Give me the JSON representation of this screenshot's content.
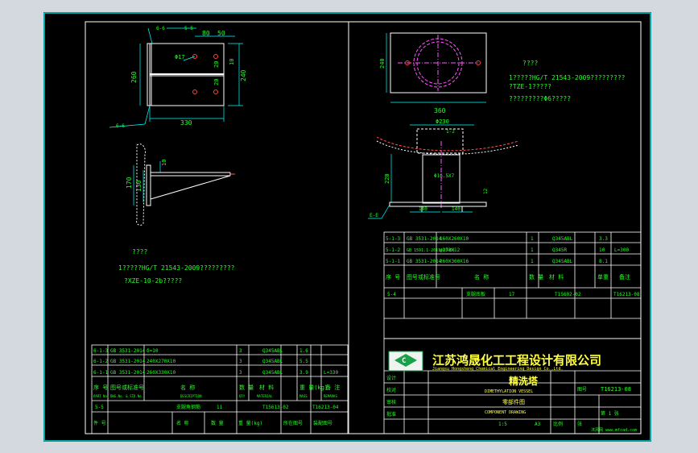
{
  "colors": {
    "background": "#000000",
    "frame": "#00e0e0",
    "drawing": "#ffffff",
    "dimension": "#00ffff",
    "text_green": "#22ff22",
    "text_yellow": "#ffff44",
    "center_line": "#ff55ff",
    "hole": "#ff4444",
    "logo_green": "#1aa04a"
  },
  "left": {
    "plan_view": {
      "section_label_a": "5-5",
      "section_label_b": "6-6",
      "section_label_c": "6-6",
      "dims": {
        "top_80": "80",
        "top_50": "50",
        "hole_dia": "Φ17",
        "right_10": "10",
        "right_240": "240",
        "left_260": "260",
        "inner_20a": "20",
        "inner_20b": "20",
        "bottom_330": "330"
      }
    },
    "side_view": {
      "dims": {
        "d_170": "170",
        "d_130": "130",
        "d_10": "10"
      }
    },
    "notes": {
      "title": "????",
      "line1": "1?????HG/T 21543-2009?????????",
      "line2": "?XZE-10-2b?????"
    },
    "parts_table": {
      "rows": [
        {
          "no": "6-1-3",
          "std": "GB 3531-2014",
          "name": "δ=10",
          "qty": "3",
          "mat": "Q345ABL",
          "w1": "1.6",
          "w2": "",
          "note": ""
        },
        {
          "no": "6-1-2",
          "std": "GB 3531-2014",
          "name": "240X270X10",
          "qty": "3",
          "mat": "Q345ABL",
          "w1": "5.5",
          "w2": "",
          "note": ""
        },
        {
          "no": "6-1-1",
          "std": "GB 3531-2014",
          "name": "260X330X10",
          "qty": "3",
          "mat": "Q345ABL",
          "w1": "3.9",
          "w2": "",
          "note": "L=330"
        }
      ],
      "header": {
        "no": "序 号",
        "std": "图号或标准号",
        "name": "名 称",
        "qty": "数 量",
        "mat": "材 料",
        "weight": "重 量(kg)",
        "note": "备 注",
        "sub_no": "PART No.",
        "sub_std": "DWG.No. & STD.No.",
        "sub_name": "DESCRIPTION",
        "sub_qty": "QTY",
        "sub_mat": "MATERIAL",
        "sub_weight": "MASS",
        "sub_note": "REMARKS"
      },
      "footer": {
        "no": "5-5",
        "name": "支腿角钢筋",
        "qty": "11",
        "drawing": "T15613-02",
        "ref": "T16213-04",
        "lbl_no": "件 号",
        "lbl_name": "名 称",
        "lbl_qty": "数 量",
        "lbl_weight": "重 量(kg)",
        "lbl_dwg": "所在图号",
        "lbl_ref": "装配图号"
      }
    }
  },
  "right": {
    "top_view": {
      "dim_240": "240",
      "dim_360": "360"
    },
    "notes": {
      "title": "????",
      "line1": "1?????HG/T 21543-2009?????????",
      "line2": "?TZE-1?????",
      "line3": "?????????Φ6?????"
    },
    "front_view": {
      "dims": {
        "phi230": "Φ230",
        "label_1_2": "1-2",
        "phi16": "Φ16.5X7",
        "d_220": "220",
        "d_140a": "140",
        "d_140b": "140",
        "d_12": "12"
      },
      "section_label": "E-E"
    },
    "parts_table": {
      "rows": [
        {
          "no": "5-1-3",
          "std": "GB 3531-2014",
          "name": "160X260X10",
          "qty": "1",
          "mat": "Q345ABL",
          "w": "3.3",
          "note": ""
        },
        {
          "no": "5-1-2",
          "std": "GB 1591.1-2011(Q345)",
          "name": "φ273X12",
          "qty": "1",
          "mat": "Q345R",
          "w": "10",
          "note": "L=300"
        },
        {
          "no": "5-1-1",
          "std": "GB 3531-2014",
          "name": "260X360X16",
          "qty": "1",
          "mat": "Q345ABL",
          "w": "8.1",
          "note": ""
        }
      ],
      "header": {
        "no": "序 号",
        "std": "图号或标准号",
        "name": "名 称",
        "qty": "数 量",
        "mat": "材 料",
        "w": "单重",
        "note": "备注"
      },
      "footer": {
        "no": "5-4",
        "name": "支腿底板",
        "qty": "17",
        "drawing": "T15602-02",
        "ref": "T16213-08"
      }
    },
    "title_block": {
      "company": "江苏鸿晟化工工程设计有限公司",
      "company_en": "Jiangsu Hongsheng Chemical Engineering Design Co.,Ltd.",
      "product": "精洗塔",
      "product_en": "DIMETHYLATION VESSEL",
      "drawing_name": "零部件图",
      "drawing_name_en": "COMPONENT DRAWING",
      "scale": "1:5",
      "size": "A3",
      "drawing_no": "T16213-08",
      "sheet": "第 1 张",
      "labels": {
        "design": "设计",
        "check": "校对",
        "review": "审核",
        "approve": "批准",
        "scale_lbl": "比例",
        "sheet_lbl": "张",
        "dwg_lbl": "图号"
      },
      "watermark": "沐风网 www.mfcad.com"
    }
  }
}
